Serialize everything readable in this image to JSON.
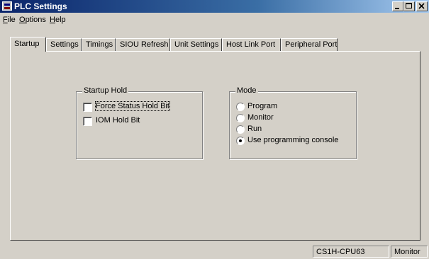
{
  "window": {
    "title": "PLC Settings"
  },
  "menu": [
    {
      "label": "File",
      "mnemonic": "F",
      "rest": "ile"
    },
    {
      "label": "Options",
      "mnemonic": "O",
      "rest": "ptions"
    },
    {
      "label": "Help",
      "mnemonic": "H",
      "rest": "elp"
    }
  ],
  "tabs": [
    "Startup",
    "Settings",
    "Timings",
    "SIOU Refresh",
    "Unit Settings",
    "Host Link Port",
    "Peripheral Port"
  ],
  "active_tab": "Startup",
  "startup_hold": {
    "label": "Startup Hold",
    "options": [
      {
        "label": "Force Status Hold Bit",
        "checked": false
      },
      {
        "label": "IOM Hold Bit",
        "checked": false
      }
    ]
  },
  "mode": {
    "label": "Mode",
    "options": [
      {
        "label": "Program",
        "selected": false
      },
      {
        "label": "Monitor",
        "selected": false
      },
      {
        "label": "Run",
        "selected": false
      },
      {
        "label": "Use programming console",
        "selected": true
      }
    ]
  },
  "status": {
    "cpu": "CS1H-CPU63",
    "mode": "Monitor"
  }
}
